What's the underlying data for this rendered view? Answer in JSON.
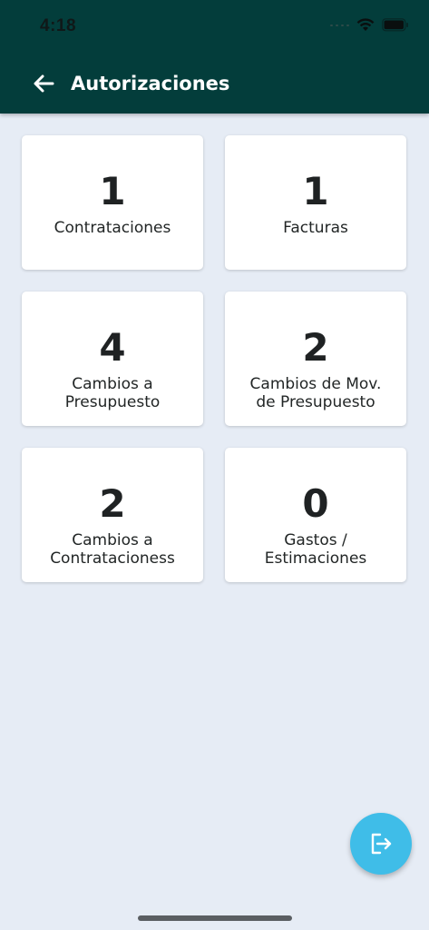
{
  "status_bar": {
    "time": "4:18"
  },
  "header": {
    "title": "Autorizaciones",
    "back_icon": "arrow-left-icon",
    "background_color": "#033d3b"
  },
  "cards": [
    {
      "count": "1",
      "label": "Contrataciones"
    },
    {
      "count": "1",
      "label": "Facturas"
    },
    {
      "count": "4",
      "label": "Cambios a\nPresupuesto"
    },
    {
      "count": "2",
      "label": "Cambios de Mov.\nde Presupuesto"
    },
    {
      "count": "2",
      "label": "Cambios a\nContratacioness"
    },
    {
      "count": "0",
      "label": "Gastos /\nEstimaciones"
    }
  ],
  "fab": {
    "icon": "logout-icon",
    "color": "#3fbde8"
  }
}
